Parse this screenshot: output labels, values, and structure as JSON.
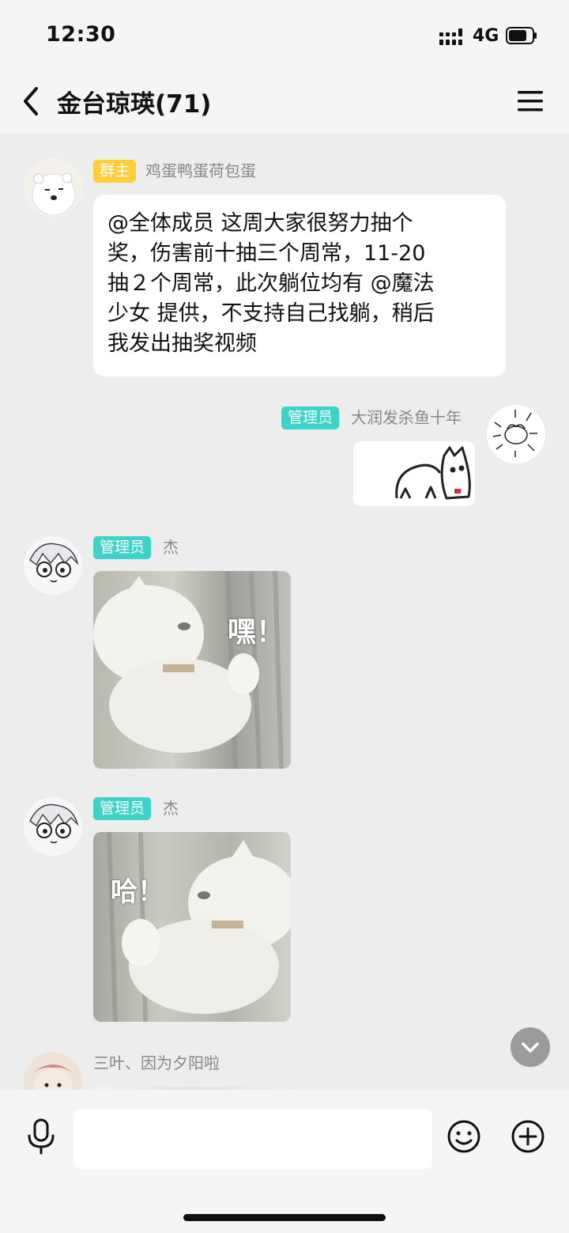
{
  "status": {
    "time": "12:30",
    "network": "4G"
  },
  "header": {
    "title": "金台琼瑛(71)"
  },
  "messages": [
    {
      "badge": "群主",
      "sender": "鸡蛋鸭蛋荷包蛋",
      "lines": [
        "@全体成员 这周大家很努力抽个",
        "奖，伤害前十抽三个周常，11-20",
        "抽２个周常，此次躺位均有 @魔法",
        "少女 提供，不支持自己找躺，稍后",
        "我发出抽奖视频"
      ]
    },
    {
      "badge": "管理员",
      "sender": "大润发杀鱼十年"
    },
    {
      "badge": "管理员",
      "sender": "杰",
      "sticker_text": "嘿！"
    },
    {
      "badge": "管理员",
      "sender": "杰",
      "sticker_text": "哈！"
    },
    {
      "sender": "三叶、因为夕阳啦"
    }
  ],
  "input": {
    "placeholder": ""
  },
  "colors": {
    "owner_badge": "#ffcf3b",
    "admin_badge": "#3dd3c8",
    "background": "#ededed"
  }
}
